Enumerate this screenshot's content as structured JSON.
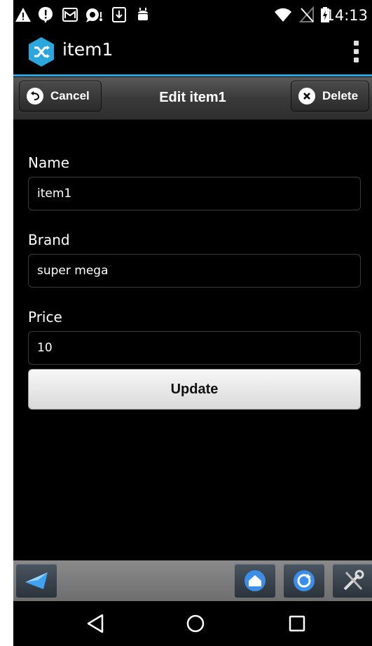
{
  "status_bar": {
    "time": "14:13",
    "left_icons": [
      "warning-icon",
      "alert-bubble-icon",
      "gmail-icon",
      "chat-icon",
      "download-icon",
      "android-debug-icon"
    ],
    "right_icons": [
      "wifi-icon",
      "no-signal-icon",
      "battery-charging-icon"
    ]
  },
  "action_bar": {
    "title": "item1",
    "app_icon": "shuffle-hexagon-icon",
    "overflow_icon": "overflow-menu-icon",
    "accent_color": "#2aa7dd"
  },
  "header": {
    "title": "Edit item1",
    "cancel_label": "Cancel",
    "delete_label": "Delete"
  },
  "form": {
    "name_label": "Name",
    "name_value": "item1",
    "brand_label": "Brand",
    "brand_value": "super mega",
    "price_label": "Price",
    "price_value": "10",
    "update_label": "Update"
  },
  "toolbar": {
    "icons": [
      "back-arrow-icon",
      "home-icon",
      "refresh-icon",
      "tools-icon"
    ]
  },
  "nav_bar": {
    "icons": [
      "nav-back-icon",
      "nav-home-icon",
      "nav-recents-icon"
    ]
  }
}
